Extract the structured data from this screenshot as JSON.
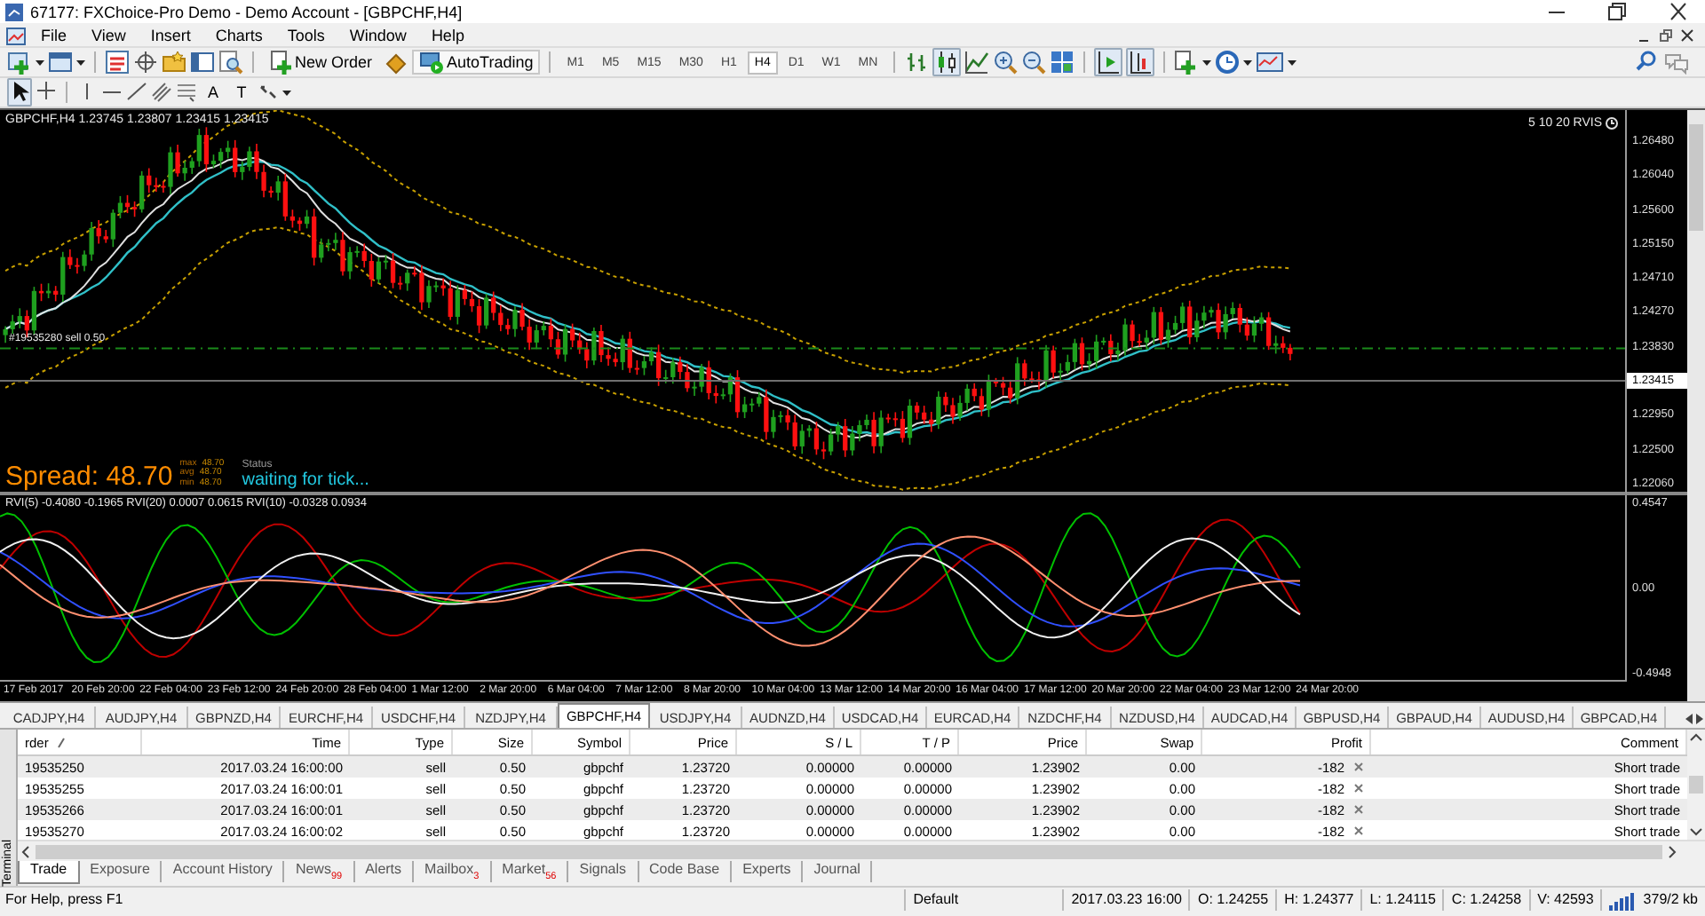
{
  "window": {
    "title": "67177: FXChoice-Pro Demo - Demo Account - [GBPCHF,H4]"
  },
  "menu": [
    "File",
    "View",
    "Insert",
    "Charts",
    "Tools",
    "Window",
    "Help"
  ],
  "toolbar": {
    "new_order": "New Order",
    "autotrading": "AutoTrading",
    "timeframes": [
      {
        "label": "M1",
        "selected": false
      },
      {
        "label": "M5",
        "selected": false
      },
      {
        "label": "M15",
        "selected": false
      },
      {
        "label": "M30",
        "selected": false
      },
      {
        "label": "H1",
        "selected": false
      },
      {
        "label": "H4",
        "selected": true
      },
      {
        "label": "D1",
        "selected": false
      },
      {
        "label": "W1",
        "selected": false
      },
      {
        "label": "MN",
        "selected": false
      }
    ],
    "text_tools": [
      "A",
      "T"
    ]
  },
  "chart": {
    "info": "GBPCHF,H4  1.23745 1.23807 1.23415 1.23415",
    "indicator_tag": "5 10 20 RVIS",
    "order_label": "#19535280 sell 0.50",
    "price_axis": [
      {
        "label": "1.26480",
        "kind": "tick"
      },
      {
        "label": "1.26040",
        "kind": "tick"
      },
      {
        "label": "1.25600",
        "kind": "tick"
      },
      {
        "label": "1.25150",
        "kind": "tick"
      },
      {
        "label": "1.24710",
        "kind": "tick"
      },
      {
        "label": "1.24270",
        "kind": "tick"
      },
      {
        "label": "1.23830",
        "kind": "tick"
      },
      {
        "label": "1.23415",
        "kind": "current"
      },
      {
        "label": "1.22950",
        "kind": "tick"
      },
      {
        "label": "1.22500",
        "kind": "tick"
      },
      {
        "label": "1.22060",
        "kind": "tick"
      }
    ],
    "spread": "Spread: 48.70",
    "spread_stats": [
      {
        "label": "max",
        "value": "48.70"
      },
      {
        "label": "avg",
        "value": "48.70"
      },
      {
        "label": "min",
        "value": "48.70"
      }
    ],
    "status_label": "Status",
    "status": "waiting for tick...",
    "oscillator_info": "RVI(5) -0.4080 -0.1965  RVI(20) 0.0007 0.0615  RVI(10) -0.0328 0.0934",
    "oscillator_axis": [
      "0.4547",
      "0.00",
      "-0.4948"
    ],
    "time_axis": [
      "17 Feb 2017",
      "20 Feb 20:00",
      "22 Feb 04:00",
      "23 Feb 12:00",
      "24 Feb 20:00",
      "28 Feb 04:00",
      "1 Mar 12:00",
      "2 Mar 20:00",
      "6 Mar 04:00",
      "7 Mar 12:00",
      "8 Mar 20:00",
      "10 Mar 04:00",
      "13 Mar 12:00",
      "14 Mar 20:00",
      "16 Mar 04:00",
      "17 Mar 12:00",
      "20 Mar 20:00",
      "22 Mar 04:00",
      "23 Mar 12:00",
      "24 Mar 20:00"
    ]
  },
  "symbol_tabs": [
    {
      "label": "CADJPY,H4",
      "selected": false
    },
    {
      "label": "AUDJPY,H4",
      "selected": false
    },
    {
      "label": "GBPNZD,H4",
      "selected": false
    },
    {
      "label": "EURCHF,H4",
      "selected": false
    },
    {
      "label": "USDCHF,H4",
      "selected": false
    },
    {
      "label": "NZDJPY,H4",
      "selected": false
    },
    {
      "label": "GBPCHF,H4",
      "selected": true
    },
    {
      "label": "USDJPY,H4",
      "selected": false
    },
    {
      "label": "AUDNZD,H4",
      "selected": false
    },
    {
      "label": "USDCAD,H4",
      "selected": false
    },
    {
      "label": "EURCAD,H4",
      "selected": false
    },
    {
      "label": "NZDCHF,H4",
      "selected": false
    },
    {
      "label": "NZDUSD,H4",
      "selected": false
    },
    {
      "label": "AUDCAD,H4",
      "selected": false
    },
    {
      "label": "GBPUSD,H4",
      "selected": false
    },
    {
      "label": "GBPAUD,H4",
      "selected": false
    },
    {
      "label": "AUDUSD,H4",
      "selected": false
    },
    {
      "label": "GBPCAD,H4",
      "selected": false
    }
  ],
  "terminal": {
    "label": "Terminal",
    "columns": [
      {
        "label": "rder",
        "sorted": true
      },
      {
        "label": "Time",
        "sorted": false
      },
      {
        "label": "Type",
        "sorted": false
      },
      {
        "label": "Size",
        "sorted": false
      },
      {
        "label": "Symbol",
        "sorted": false
      },
      {
        "label": "Price",
        "sorted": false
      },
      {
        "label": "S / L",
        "sorted": false
      },
      {
        "label": "T / P",
        "sorted": false
      },
      {
        "label": "Price",
        "sorted": false
      },
      {
        "label": "Swap",
        "sorted": false
      },
      {
        "label": "Profit",
        "sorted": false,
        "kind": "profit"
      },
      {
        "label": "Comment",
        "sorted": false
      }
    ],
    "rows": [
      [
        "19535250",
        "2017.03.24 16:00:00",
        "sell",
        "0.50",
        "gbpchf",
        "1.23720",
        "0.00000",
        "0.00000",
        "1.23902",
        "0.00",
        "-182",
        "Short trade"
      ],
      [
        "19535255",
        "2017.03.24 16:00:01",
        "sell",
        "0.50",
        "gbpchf",
        "1.23720",
        "0.00000",
        "0.00000",
        "1.23902",
        "0.00",
        "-182",
        "Short trade"
      ],
      [
        "19535266",
        "2017.03.24 16:00:01",
        "sell",
        "0.50",
        "gbpchf",
        "1.23720",
        "0.00000",
        "0.00000",
        "1.23902",
        "0.00",
        "-182",
        "Short trade"
      ],
      [
        "19535270",
        "2017.03.24 16:00:02",
        "sell",
        "0.50",
        "gbpchf",
        "1.23720",
        "0.00000",
        "0.00000",
        "1.23902",
        "0.00",
        "-182",
        "Short trade"
      ]
    ],
    "tabs": [
      {
        "label": "Trade",
        "selected": true
      },
      {
        "label": "Exposure",
        "selected": false
      },
      {
        "label": "Account History",
        "selected": false
      },
      {
        "label": "News",
        "badge": "99",
        "selected": false
      },
      {
        "label": "Alerts",
        "selected": false
      },
      {
        "label": "Mailbox",
        "badge": "3",
        "selected": false
      },
      {
        "label": "Market",
        "badge": "56",
        "selected": false
      },
      {
        "label": "Signals",
        "selected": false
      },
      {
        "label": "Code Base",
        "selected": false
      },
      {
        "label": "Experts",
        "selected": false
      },
      {
        "label": "Journal",
        "selected": false
      }
    ]
  },
  "status_bar": {
    "help": "For Help, press F1",
    "profile": "Default",
    "time": "2017.03.23 16:00",
    "open": "O: 1.24255",
    "high": "H: 1.24377",
    "low": "L: 1.24115",
    "close": "C: 1.24258",
    "volume": "V: 42593",
    "traffic": "379/2 kb"
  }
}
